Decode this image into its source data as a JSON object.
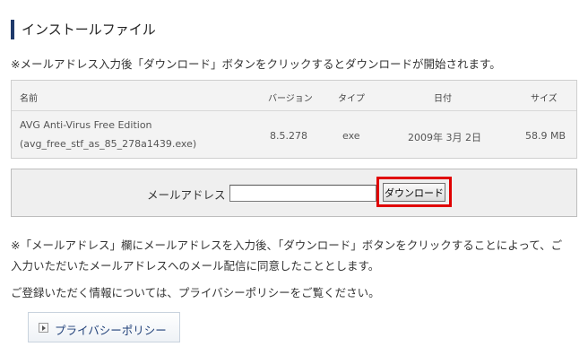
{
  "section": {
    "title": "インストールファイル"
  },
  "intro_note": "※メールアドレス入力後「ダウンロード」ボタンをクリックするとダウンロードが開始されます。",
  "file_table": {
    "columns": [
      "名前",
      "バージョン",
      "タイプ",
      "日付",
      "サイズ"
    ],
    "row": {
      "name_line1": "AVG Anti-Virus Free Edition",
      "name_line2": "(avg_free_stf_as_85_278a1439.exe)",
      "version": "8.5.278",
      "type": "exe",
      "date": "2009年 3月 2日",
      "size": "58.9 MB"
    }
  },
  "form": {
    "email_label": "メールアドレス",
    "email_value": "",
    "download_label": "ダウンロード"
  },
  "agreement_note": "※「メールアドレス」欄にメールアドレスを入力後、「ダウンロード」ボタンをクリックすることによって、ご入力いただいたメールアドレスへのメール配信に同意したこととします。",
  "privacy_note": "ご登録いただく情報については、プライバシーポリシーをご覧ください。",
  "privacy_button": {
    "label": "プライバシーポリシー",
    "icon": "arrow-right-icon"
  },
  "colors": {
    "title_bar": "#1f3a6b",
    "highlight": "#e00000",
    "link": "#1f3f78"
  }
}
